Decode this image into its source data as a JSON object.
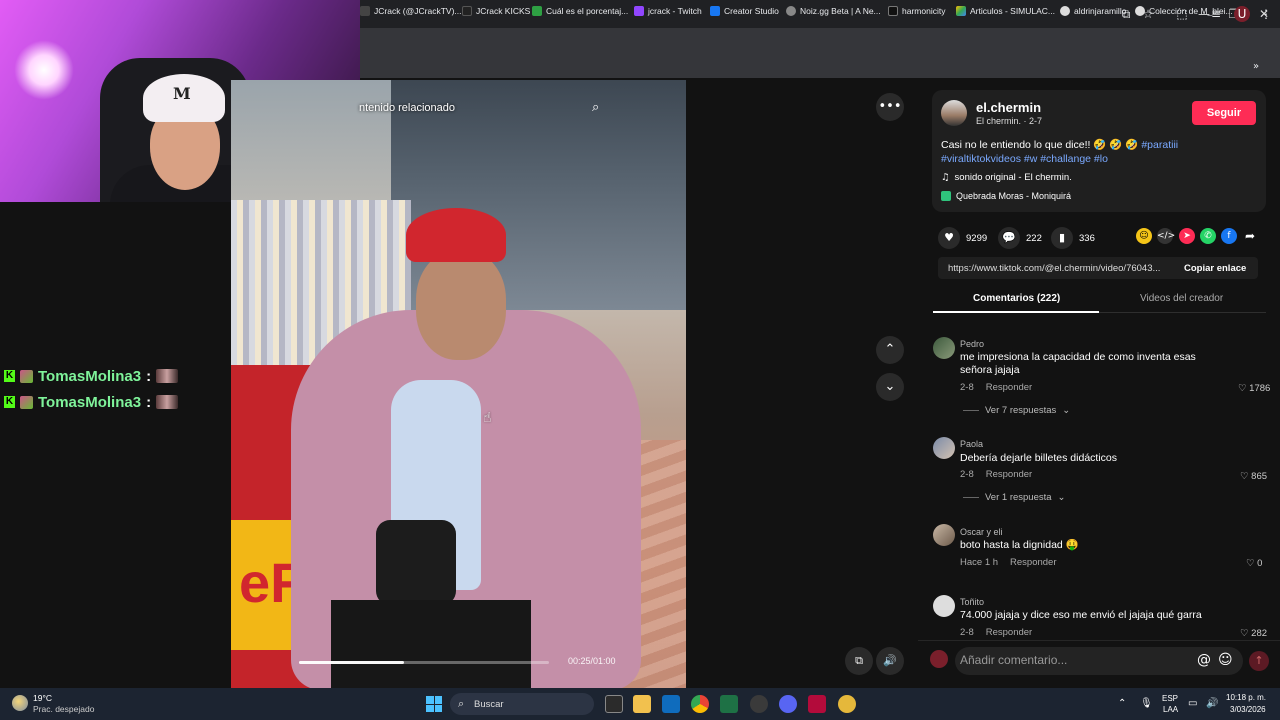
{
  "browser": {
    "bookmarks": [
      "JCrack (@JCrackTV)...",
      "JCrack KICKS",
      "Cuál es el porcentaj...",
      "jcrack - Twitch",
      "Creator Studio",
      "Noiz.gg Beta | A Ne...",
      "harmonicity",
      "Articulos - SIMULAC...",
      "aldrinjaramillo",
      "Colección de M_blei..."
    ]
  },
  "chat": {
    "lines": [
      {
        "user": "TomasMolina3",
        "sep": ":"
      },
      {
        "user": "TomasMolina3",
        "sep": ":"
      }
    ]
  },
  "video": {
    "related_text": "ntenido relacionado",
    "time": "00:25/01:00",
    "progress_fraction": 0.42,
    "overlay_labels": {
      "cap_logo": "M",
      "sign": "eR"
    }
  },
  "post": {
    "author_name": "el.chermin",
    "author_sub": "El chermin. · 2-7",
    "follow": "Seguir",
    "caption_text": "Casi no le entiendo lo que dice!! 🤣 🤣 🤣",
    "hashtags_line1": "#paratiii",
    "hashtags_line2": "#viraltiktokvideos #w #challange #lo",
    "sound": "sonido original - El chermin.",
    "location": "Quebrada Moras - Moniquirá",
    "likes": "9299",
    "comments": "222",
    "saves": "336",
    "link": "https://www.tiktok.com/@el.chermin/video/76043...",
    "copy_link": "Copiar enlace"
  },
  "tabs": {
    "comments": "Comentarios (222)",
    "creator_videos": "Videos del creador"
  },
  "comments": [
    {
      "user": "Pedro",
      "text": "me impresiona la capacidad de como inventa esas señora jajaja",
      "time": "2-8",
      "reply": "Responder",
      "likes": "1786",
      "replies": "Ver 7 respuestas"
    },
    {
      "user": "Paola",
      "text": "Debería dejarle billetes didácticos",
      "time": "2-8",
      "reply": "Responder",
      "likes": "865",
      "replies": "Ver 1 respuesta"
    },
    {
      "user": "Oscar y eli",
      "text": "boto hasta la dignidad 🤑",
      "time": "Hace 1 h",
      "reply": "Responder",
      "likes": "0"
    },
    {
      "user": "Toñito",
      "text": "74.000 jajaja y dice eso me envió el jajaja qué garra",
      "time": "2-8",
      "reply": "Responder",
      "likes": "282"
    }
  ],
  "comment_input": {
    "placeholder": "Añadir comentario..."
  },
  "taskbar": {
    "temp": "19°C",
    "weather": "Prac. despejado",
    "search": "Buscar",
    "lang1": "ESP",
    "lang2": "LAA",
    "time": "10:18 p. m.",
    "date": "3/03/2026"
  },
  "colors": {
    "follow": "#fe2c55",
    "hashtag": "#7aa9ff",
    "chat_name": "#7ff39a",
    "kick": "#53fc18"
  }
}
